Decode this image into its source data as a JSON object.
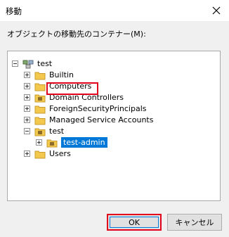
{
  "window": {
    "title": "移動"
  },
  "prompt": "オブジェクトの移動先のコンテナー(M):",
  "tree": {
    "root": "test",
    "items": [
      {
        "label": "Builtin"
      },
      {
        "label": "Computers"
      },
      {
        "label": "Domain Controllers"
      },
      {
        "label": "ForeignSecurityPrincipals"
      },
      {
        "label": "Managed Service Accounts"
      },
      {
        "label": "test"
      },
      {
        "label": "test-admin"
      },
      {
        "label": "Users"
      }
    ]
  },
  "buttons": {
    "ok": "OK",
    "cancel": "キャンセル"
  },
  "colors": {
    "selection": "#0078d7",
    "highlight_box": "#e0001b",
    "folder": "#e8b84d"
  }
}
